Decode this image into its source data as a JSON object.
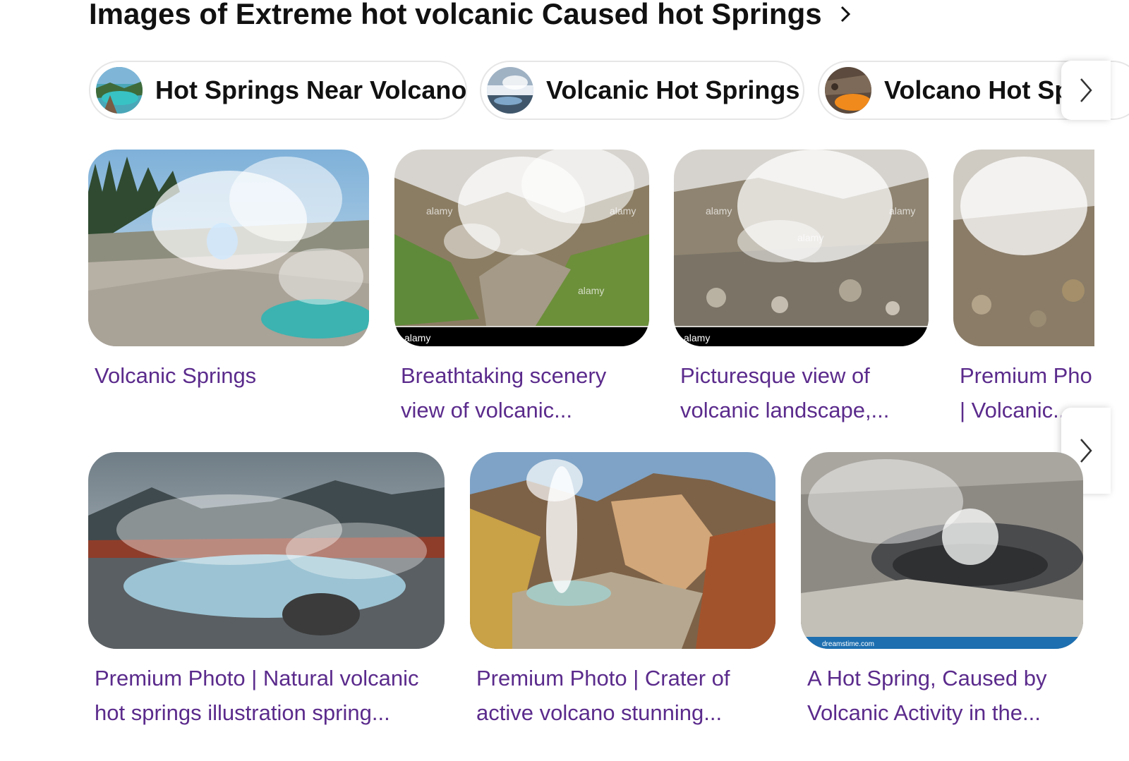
{
  "heading": {
    "title": "Images of Extreme hot volcanic Caused hot Springs"
  },
  "chips": [
    {
      "label": "Hot Springs Near Volcano"
    },
    {
      "label": "Volcanic Hot Springs"
    },
    {
      "label": "Volcano Hot Spr"
    }
  ],
  "row1": [
    {
      "line1": "Volcanic Springs",
      "line2": ""
    },
    {
      "line1": "Breathtaking scenery",
      "line2": "view of volcanic..."
    },
    {
      "line1": "Picturesque view of",
      "line2": "volcanic landscape,..."
    },
    {
      "line1": "Premium Pho",
      "line2": "| Volcanic..."
    }
  ],
  "row2": [
    {
      "line1": "Premium Photo | Natural volcanic",
      "line2": "hot springs illustration spring..."
    },
    {
      "line1": "Premium Photo | Crater of",
      "line2": "active volcano stunning..."
    },
    {
      "line1": "A Hot Spring, Caused by",
      "line2": "Volcanic Activity in the..."
    }
  ],
  "watermarks": {
    "alamy": "alamy",
    "dreamstime": "dreamstime.com"
  },
  "colors": {
    "caption": "#5b2b8c",
    "heading": "#111111",
    "chip_border": "#e6e6e6"
  }
}
